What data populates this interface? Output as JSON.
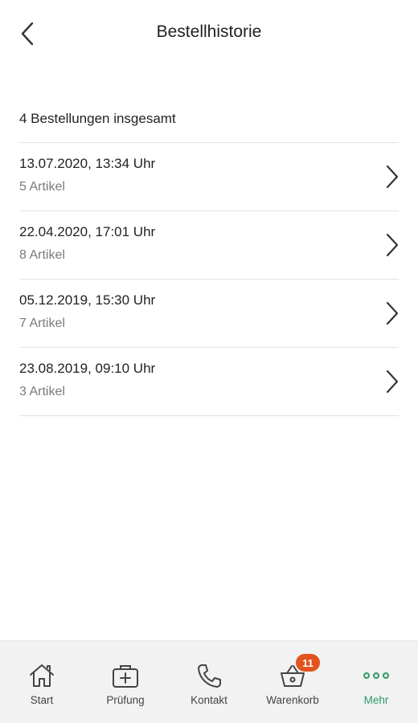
{
  "header": {
    "title": "Bestellhistorie"
  },
  "summary": "4 Bestellungen insgesamt",
  "orders": [
    {
      "date": "13.07.2020, 13:34 Uhr",
      "items": "5 Artikel"
    },
    {
      "date": "22.04.2020, 17:01 Uhr",
      "items": "8 Artikel"
    },
    {
      "date": "05.12.2019, 15:30 Uhr",
      "items": "7 Artikel"
    },
    {
      "date": "23.08.2019, 09:10 Uhr",
      "items": "3 Artikel"
    }
  ],
  "tabbar": {
    "tabs": [
      {
        "label": "Start",
        "icon": "home-icon"
      },
      {
        "label": "Prüfung",
        "icon": "medical-bag-icon"
      },
      {
        "label": "Kontakt",
        "icon": "phone-icon"
      },
      {
        "label": "Warenkorb",
        "icon": "basket-icon",
        "badge": "11"
      },
      {
        "label": "Mehr",
        "icon": "more-dots-icon",
        "active": true
      }
    ]
  },
  "colors": {
    "accent": "#2e9a66",
    "badge": "#e2531e",
    "tabbar_bg": "#f2f2f2",
    "divider": "#e2e2e2"
  }
}
